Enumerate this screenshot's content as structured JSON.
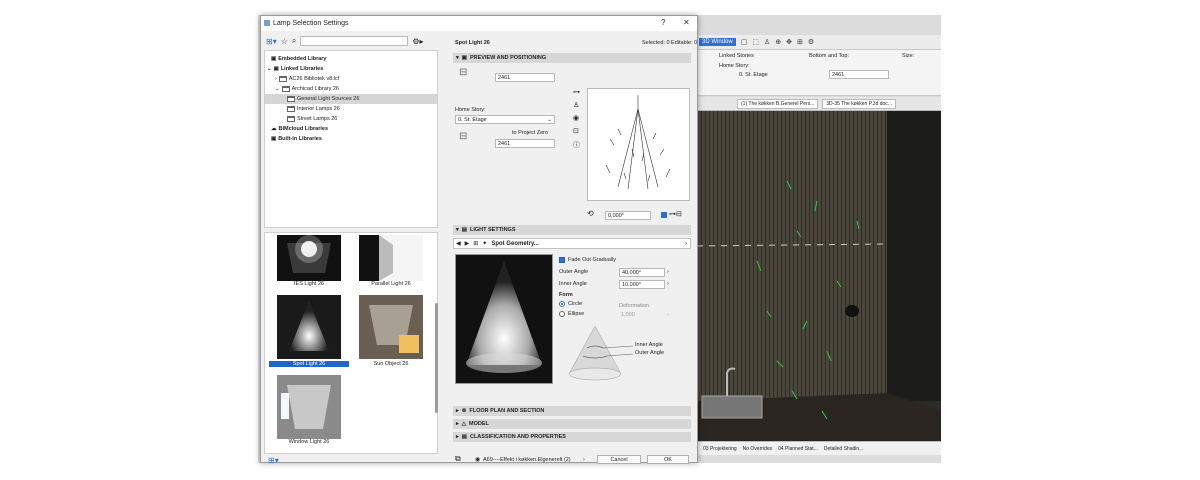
{
  "window_title": "Lamp Selection Settings",
  "title_buttons": {
    "help": "?",
    "close": "✕"
  },
  "search": {
    "placeholder": ""
  },
  "tree": [
    {
      "label": "Embedded Library",
      "bold": true
    },
    {
      "label": "Linked Libraries",
      "bold": true
    },
    {
      "label": "AC26 Bibliotek v8.lcf",
      "bold": false
    },
    {
      "label": "Archicad Library 26",
      "bold": false
    },
    {
      "label": "General Light Sources 26",
      "bold": false,
      "selected": true
    },
    {
      "label": "Interior Lamps 26",
      "bold": false
    },
    {
      "label": "Street Lamps 26",
      "bold": false
    },
    {
      "label": "BIMcloud Libraries",
      "bold": true
    },
    {
      "label": "Built-in Libraries",
      "bold": true
    }
  ],
  "thumbnails": [
    {
      "label": "IES Light 26",
      "selected": false
    },
    {
      "label": "Parallel Light 26",
      "selected": false
    },
    {
      "label": "Spot Light 26",
      "selected": true
    },
    {
      "label": "Sun Object 26",
      "selected": false
    },
    {
      "label": "Window Light 26",
      "selected": false
    }
  ],
  "object_name": "Spot Light 26",
  "selected_info": "Selected: 0 Editable: 0",
  "preview_section": "PREVIEW AND POSITIONING",
  "elevation_top": "2461",
  "home_story_label": "Home Story:",
  "home_story_value": "0. St. Etage",
  "to_project_zero": "to Project Zero",
  "elevation_bottom": "2461",
  "rotation_angle": "0,000°",
  "light_section": "LIGHT SETTINGS",
  "light_page": "Spot Geometry...",
  "fade_out": "Fade Out Gradually",
  "outer_angle_label": "Outer Angle",
  "outer_angle_value": "40,000°",
  "inner_angle_label": "Inner Angle",
  "inner_angle_value": "10,000°",
  "form_label": "Form",
  "circle_label": "Circle",
  "ellipse_label": "Ellipse",
  "deformation_label": "Deformation",
  "deformation_value": "1,000",
  "diagram_inner": "Inner Angle",
  "diagram_outer": "Outer Angle",
  "floor_plan_section": "FLOOR PLAN AND SECTION",
  "model_section": "MODEL",
  "classification_section": "CLASSIFICATION AND PROPERTIES",
  "layer_value": "A69----Effekt i køkken.Elgenerelt (2)",
  "cancel_label": "Cancel",
  "ok_label": "OK",
  "bg": {
    "window_btn": "3D Window",
    "linked_stories": "Linked Stories",
    "home_story": "Home Story:",
    "home_story_val": "0. St. Etage",
    "bottom_top": "Bottom and Top:",
    "size": "Size:",
    "elev": "2461",
    "tab1": "(1) The køkken B.Generel Pers...",
    "tab2": "3D-35 The køkken P.3d doc...",
    "status1": "03 Projektering",
    "status2": "No Overrides",
    "status3": "04 Planned Stat...",
    "status4": "Detailed Shadin..."
  }
}
